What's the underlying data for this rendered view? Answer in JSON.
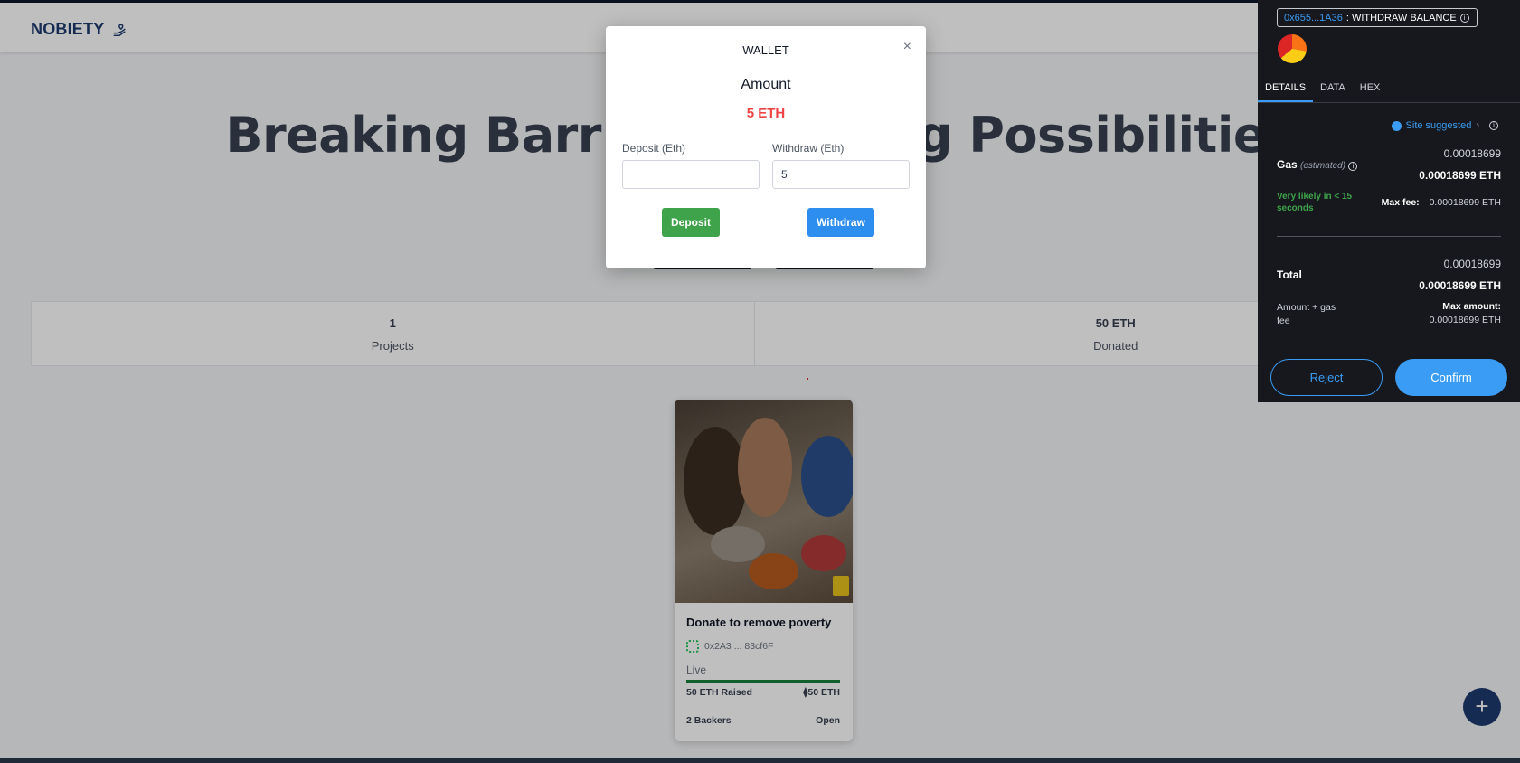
{
  "navbar": {
    "brand": "NOBIETY",
    "brand_icon": "hand-heart-icon"
  },
  "hero": {
    "title_left": "Breaking Barr",
    "title_right": "g Possibilities"
  },
  "stats": [
    {
      "value": "1",
      "label": "Projects"
    },
    {
      "value": "50 ETH",
      "label": "Donated"
    }
  ],
  "project_card": {
    "title": "Donate to remove poverty",
    "owner": "0x2A3 ... 83cf6F",
    "status": "Live",
    "progress_fraction": 1.0,
    "raised": "50 ETH Raised",
    "goal": "50 ETH",
    "backers": "2 Backers",
    "state": "Open"
  },
  "fab": {
    "label": "+"
  },
  "wallet_modal": {
    "title": "WALLET",
    "close": "×",
    "amount_label": "Amount",
    "amount_value": "5 ETH",
    "deposit_label": "Deposit (Eth)",
    "deposit_value": "",
    "withdraw_label": "Withdraw (Eth)",
    "withdraw_value": "5",
    "deposit_button": "Deposit",
    "withdraw_button": "Withdraw"
  },
  "metamask": {
    "site_address": "0x655...1A36",
    "site_action": ": WITHDRAW BALANCE",
    "tabs": [
      "DETAILS",
      "DATA",
      "HEX"
    ],
    "active_tab": "DETAILS",
    "site_suggested": "Site suggested",
    "gas_label": "Gas",
    "gas_estimated": "(estimated)",
    "gas_value": "0.00018699",
    "gas_value_eth": "0.00018699 ETH",
    "likely": "Very likely in < 15 seconds",
    "max_fee_label": "Max fee:",
    "max_fee_value": "0.00018699 ETH",
    "total_label": "Total",
    "total_value": "0.00018699",
    "total_value_eth": "0.00018699 ETH",
    "amount_gas_label": "Amount + gas fee",
    "max_amount_label": "Max amount:",
    "max_amount_value": "0.00018699 ETH",
    "reject_button": "Reject",
    "confirm_button": "Confirm",
    "colors": {
      "accent": "#3b9cf5",
      "success": "#3ea34a",
      "background": "#16181d"
    }
  }
}
